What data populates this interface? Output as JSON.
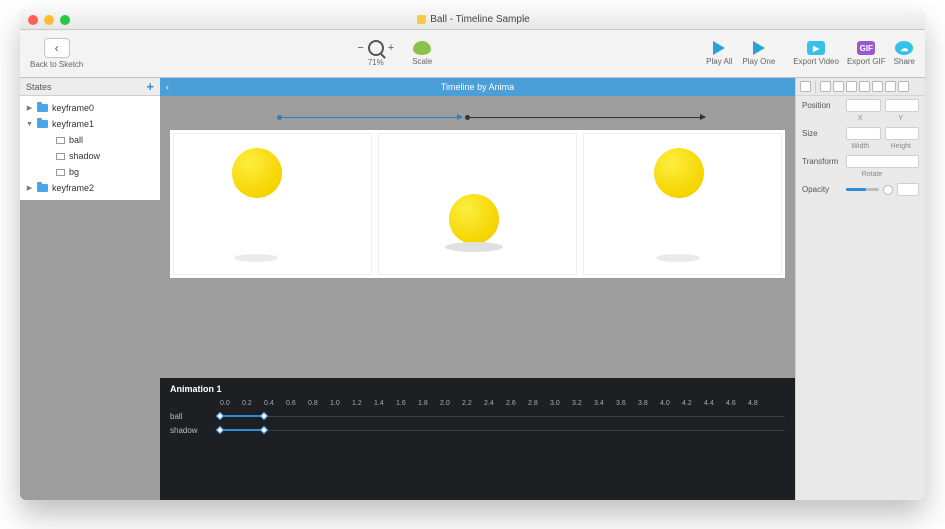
{
  "window": {
    "title": "Ball - Timeline Sample"
  },
  "toolbar": {
    "back_label": "Back to Sketch",
    "zoom_percent": "71%",
    "scale_label": "Scale",
    "play_all": "Play All",
    "play_one": "Play One",
    "export_video": "Export Video",
    "export_gif": "Export GIF",
    "share": "Share"
  },
  "states": {
    "header": "States",
    "items": [
      {
        "name": "keyframe0",
        "type": "folder",
        "expanded": false
      },
      {
        "name": "keyframe1",
        "type": "folder",
        "expanded": true,
        "children": [
          {
            "name": "ball",
            "type": "layer"
          },
          {
            "name": "shadow",
            "type": "layer"
          },
          {
            "name": "bg",
            "type": "layer"
          }
        ]
      },
      {
        "name": "keyframe2",
        "type": "folder",
        "expanded": false
      }
    ]
  },
  "bluebar": {
    "title": "Timeline by Anima"
  },
  "timeline": {
    "title": "Animation 1",
    "ticks": [
      "0.0",
      "0.2",
      "0.4",
      "0.6",
      "0.8",
      "1.0",
      "1.2",
      "1.4",
      "1.6",
      "1.8",
      "2.0",
      "2.2",
      "2.4",
      "2.6",
      "2.8",
      "3.0",
      "3.2",
      "3.4",
      "3.6",
      "3.8",
      "4.0",
      "4.2",
      "4.4",
      "4.6",
      "4.8"
    ],
    "tracks": [
      {
        "name": "ball"
      },
      {
        "name": "shadow"
      }
    ]
  },
  "inspector": {
    "position": "Position",
    "x": "X",
    "y": "Y",
    "size": "Size",
    "width": "Width",
    "height": "Height",
    "transform": "Transform",
    "rotate": "Rotate",
    "opacity": "Opacity"
  }
}
